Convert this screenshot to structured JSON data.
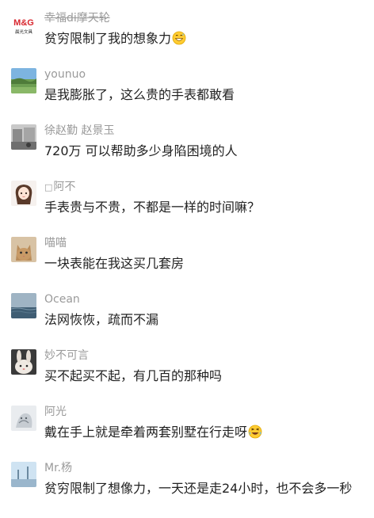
{
  "comments": [
    {
      "name": "幸福di摩天轮",
      "avatar": "mg-logo-avatar",
      "avatar_text": "M&G",
      "avatar_subtext": "晨光文具",
      "text": "贫穷限制了我的想象力",
      "emoji": "grinning-sweat-emoji"
    },
    {
      "name": "younuo",
      "avatar": "landscape-avatar",
      "text": "是我膨胀了，这么贵的手表都敢看"
    },
    {
      "name": "徐赵勤  赵景玉",
      "avatar": "street-photo-avatar",
      "text": "720万 可以帮助多少身陷困境的人"
    },
    {
      "name": "阿不",
      "name_prefix": "□",
      "avatar": "cartoon-girl-avatar",
      "text": "手表贵与不贵，不都是一样的时间嘛？"
    },
    {
      "name": "喵喵",
      "avatar": "cat-avatar",
      "text": "一块表能在我这买几套房"
    },
    {
      "name": "Ocean",
      "avatar": "ocean-avatar",
      "text": "法网恢恢，疏而不漏"
    },
    {
      "name": "妙不可言",
      "avatar": "bunny-avatar",
      "text": "买不起买不起，有几百的那种吗"
    },
    {
      "name": "阿光",
      "avatar": "sketch-avatar",
      "text": "戴在手上就是牵着两套别墅在行走呀",
      "emoji": "laughing-tears-emoji"
    },
    {
      "name": "Mr.杨",
      "avatar": "sky-avatar",
      "text": "贫穷限制了想像力，一天还是走24小时，也不会多一秒"
    }
  ]
}
